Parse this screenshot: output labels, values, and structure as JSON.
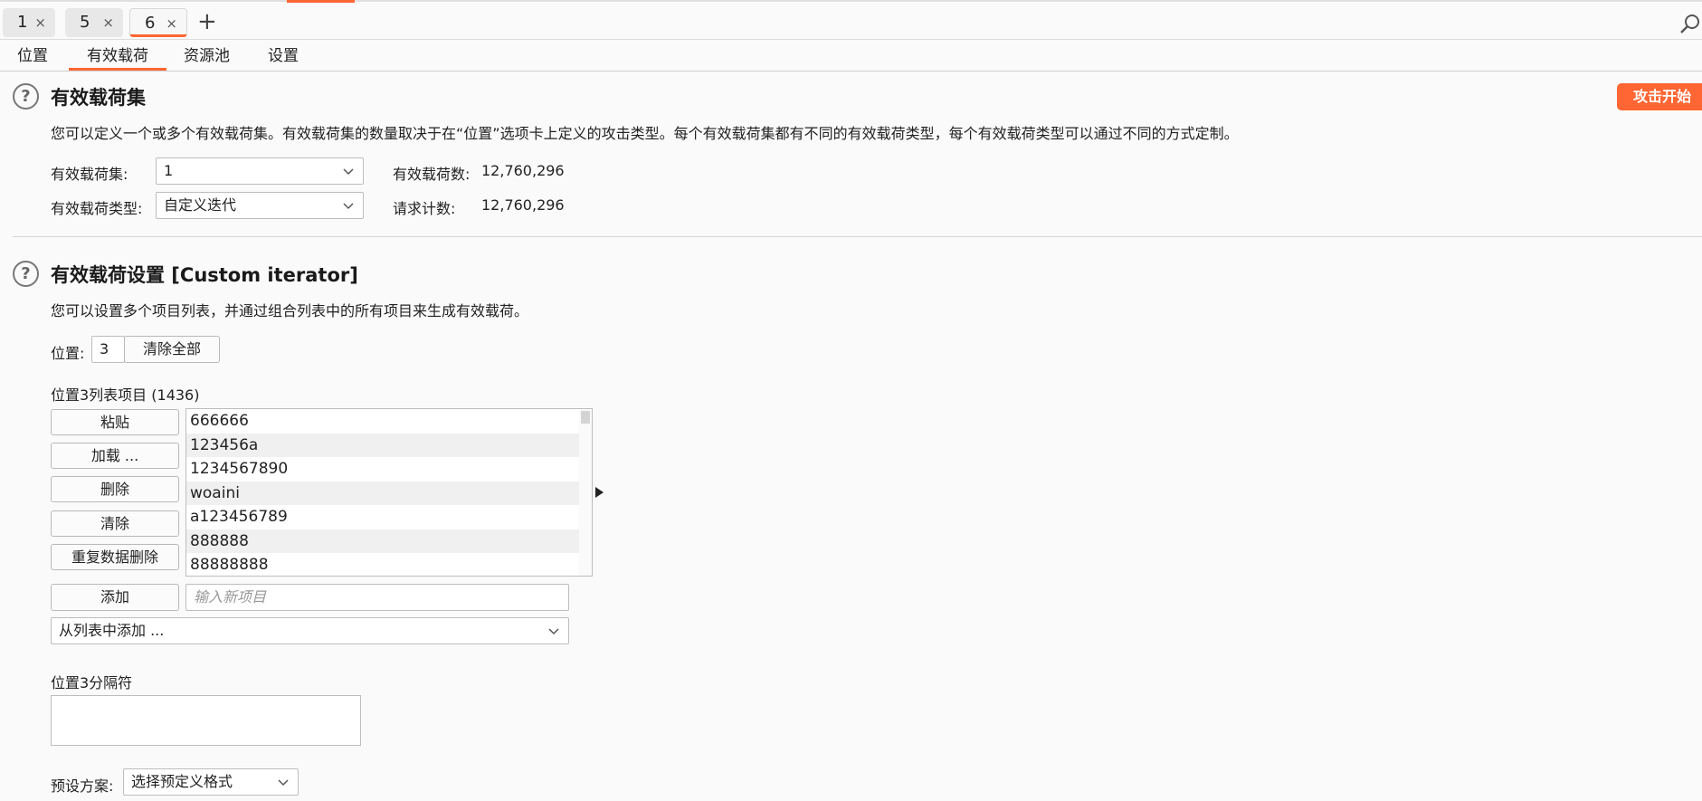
{
  "request_tabs": [
    {
      "label": "1",
      "close": "×"
    },
    {
      "label": "5",
      "close": "×"
    },
    {
      "label": "6",
      "close": "×"
    }
  ],
  "new_tab_label": "+",
  "sub_tabs": [
    "位置",
    "有效载荷",
    "资源池",
    "设置"
  ],
  "payload_sets": {
    "title": "有效载荷集",
    "description": "您可以定义一个或多个有效载荷集。有效载荷集的数量取决于在“位置”选项卡上定义的攻击类型。每个有效载荷集都有不同的有效载荷类型，每个有效载荷类型可以通过不同的方式定制。",
    "set_label": "有效载荷集:",
    "set_value": "1",
    "type_label": "有效载荷类型:",
    "type_value": "自定义迭代",
    "count_label": "有效载荷数:",
    "count_value": "12,760,296",
    "request_label": "请求计数:",
    "request_value": "12,760,296",
    "start_button": "攻击开始"
  },
  "payload_settings": {
    "title": "有效载荷设置 [Custom iterator]",
    "description": "您可以设置多个项目列表，并通过组合列表中的所有项目来生成有效载荷。",
    "position_label": "位置:",
    "position_value": "3",
    "clear_all": "清除全部",
    "list_title": "位置3列表项目 (1436)",
    "buttons": {
      "paste": "粘贴",
      "load": "加载 ...",
      "remove": "删除",
      "clear": "清除",
      "dedupe": "重复数据删除",
      "add": "添加"
    },
    "items": [
      "666666",
      "123456a",
      "1234567890",
      "woaini",
      "a123456789",
      "888888",
      "88888888"
    ],
    "add_placeholder": "输入新项目",
    "add_from_list": "从列表中添加 ...",
    "separator_label": "位置3分隔符",
    "preset_label": "预设方案:",
    "preset_value": "选择预定义格式"
  },
  "help_glyph": "?",
  "colors": {
    "accent": "#ff6633"
  }
}
